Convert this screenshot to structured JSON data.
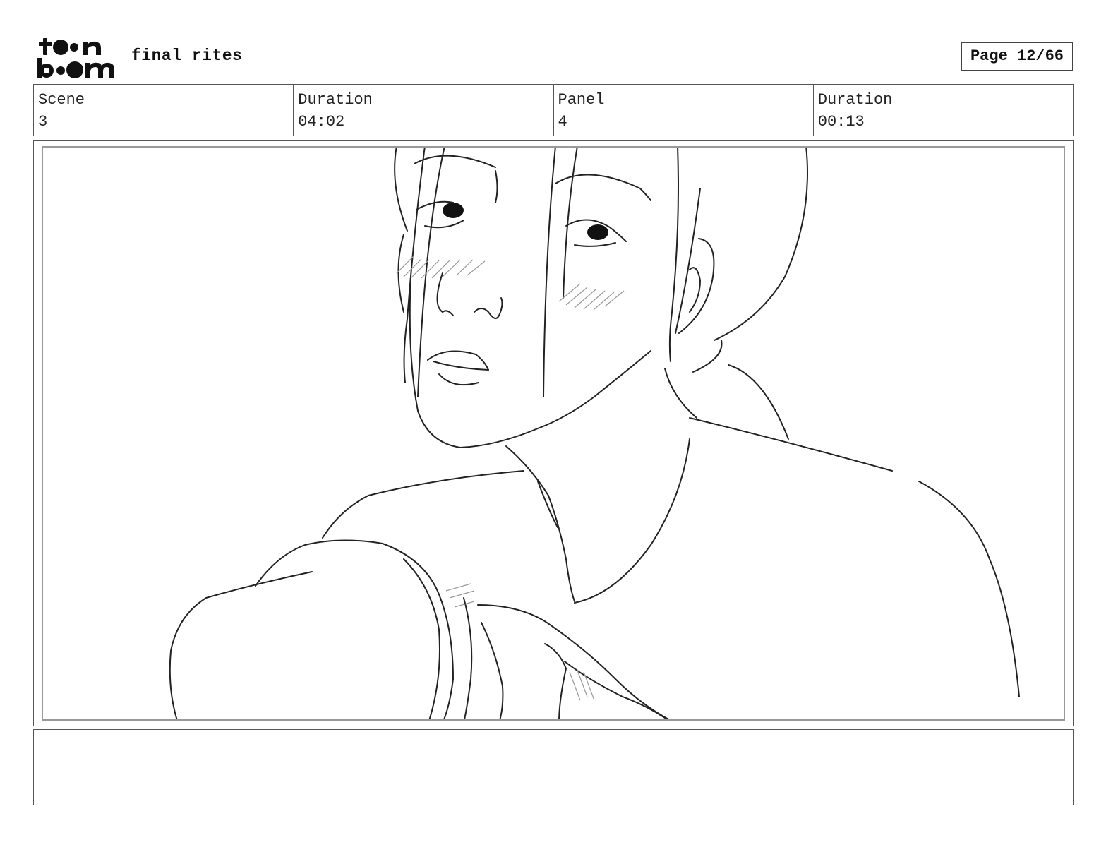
{
  "header": {
    "logo": {
      "icon": "toon-boom-logo",
      "text_line1": "toon",
      "text_line2": "boom"
    },
    "project_title": "final rites",
    "page_label": "Page 12/66"
  },
  "info": {
    "scene_label": "Scene",
    "scene_value": "3",
    "scene_duration_label": "Duration",
    "scene_duration_value": "04:02",
    "panel_label": "Panel",
    "panel_value": "4",
    "panel_duration_label": "Duration",
    "panel_duration_value": "00:13"
  },
  "panel": {
    "image": "line-sketch-of-woman-facing-camera-with-arm-in-foreground"
  },
  "notes": {
    "text": ""
  }
}
